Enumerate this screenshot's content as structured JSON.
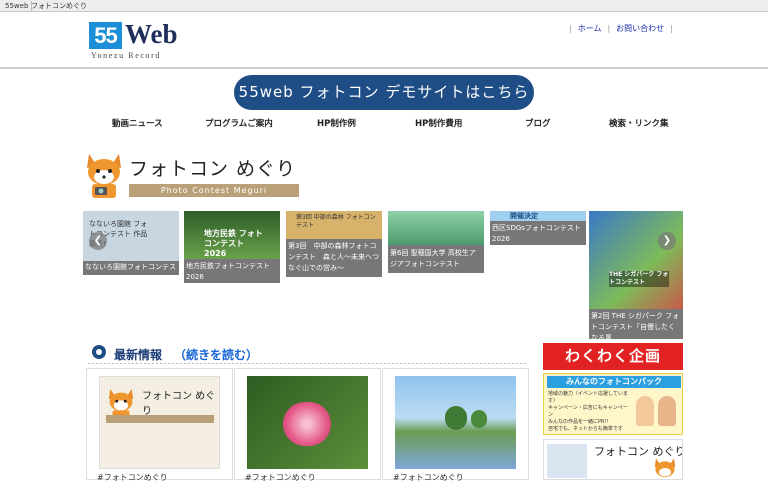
{
  "tabs": [
    {
      "label": "55web"
    },
    {
      "label": "フォトコンめぐり"
    }
  ],
  "logo": {
    "number": "55",
    "word": "Web",
    "subtitle": "Yonezu Record"
  },
  "toplinks": {
    "home": "ホーム",
    "contact": "お問い合わせ"
  },
  "demo_button": "55web フォトコン デモサイトはこちら",
  "nav": [
    {
      "label": "動画ニュース"
    },
    {
      "label": "プログラムご案内"
    },
    {
      "label": "HP制作例"
    },
    {
      "label": "HP制作費用"
    },
    {
      "label": "ブログ"
    },
    {
      "label": "検索・リンク集"
    }
  ],
  "banner": {
    "title": "フォトコン めぐり",
    "subtitle": "Photo Contest Meguri"
  },
  "carousel": [
    {
      "caption": "なないろ園館フォトコンテスト",
      "img_text": "なないろ園館 フォトコンテスト 作品募集!",
      "color": "#b9c9d8"
    },
    {
      "caption": "地方民鉄フォトコンテスト2026",
      "img_text": "地方民鉄 フォトコンテスト 2026",
      "color": "#3f7a3a"
    },
    {
      "caption": "第3回　中部の森林フォトコンテスト　森と人〜未来へつなぐ山での営み〜",
      "img_text": "第3回 中部の森林 フォトコンテスト",
      "color": "#c9a25a"
    },
    {
      "caption": "第6回 聖穂国大学 高校生アジアフォトコンテスト",
      "img_text": "",
      "color": "#5aa28a"
    },
    {
      "caption": "西区SDGsフォトコンテスト2026",
      "img_text": "開催決定",
      "color": "#6fb3da"
    },
    {
      "caption": "第2回 THE シガパーク フォトコンテスト「自慢したくなる風",
      "img_text": "THE シガパーク フォトコンテスト",
      "color": "#3a6fa8"
    }
  ],
  "section": {
    "title": "最新情報",
    "more": "（続きを読む）"
  },
  "posts": [
    {
      "tag": "#フォトコンめぐり",
      "thumb": "フォトコン めぐり"
    },
    {
      "tag": "#フォトコンめぐり",
      "thumb": ""
    },
    {
      "tag": "#フォトコンめぐり",
      "thumb": ""
    }
  ],
  "sidebar": {
    "head": "わくわく企画",
    "pack_title": "みんなのフォトコンパック",
    "pack_lines": [
      "地域の魅力（イベント応援しています）",
      "キャンペーン・広告にもキャンペーン",
      "みんなの作品を一緒にPR!!",
      "自宅でも、ネットからも簡単です"
    ],
    "meguri_title": "フォトコン めぐり"
  },
  "colors": {
    "accent": "#1f4e86",
    "logo_blue": "#1d8fd8",
    "side_red": "#e22222"
  }
}
